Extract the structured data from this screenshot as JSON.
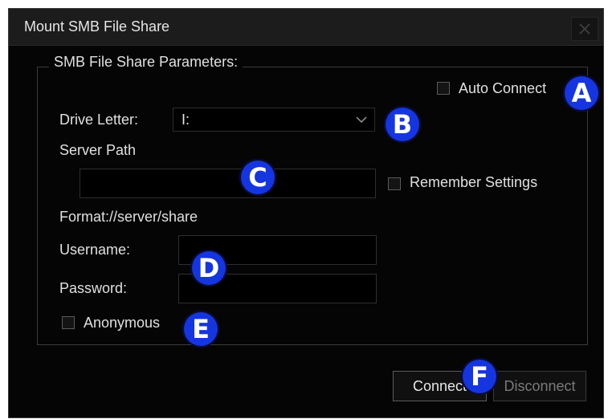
{
  "dialog": {
    "title": "Mount SMB File Share",
    "close_label": "X",
    "group_label": "SMB File Share Parameters:",
    "auto_connect_label": "Auto Connect",
    "drive_letter_label": "Drive Letter:",
    "drive_letter_value": "I:",
    "server_path_label": "Server Path",
    "remember_settings_label": "Remember Settings",
    "format_hint": "Format://server/share",
    "username_label": "Username:",
    "password_label": "Password:",
    "anonymous_label": "Anonymous",
    "connect_label": "Connect",
    "disconnect_label": "Disconnect"
  },
  "markers": [
    "A",
    "B",
    "C",
    "D",
    "E",
    "F"
  ],
  "colors": {
    "background": "#050505",
    "titlebar": "#1c1c1c",
    "text": "#e0e0e0",
    "marker": "#1535e0"
  }
}
